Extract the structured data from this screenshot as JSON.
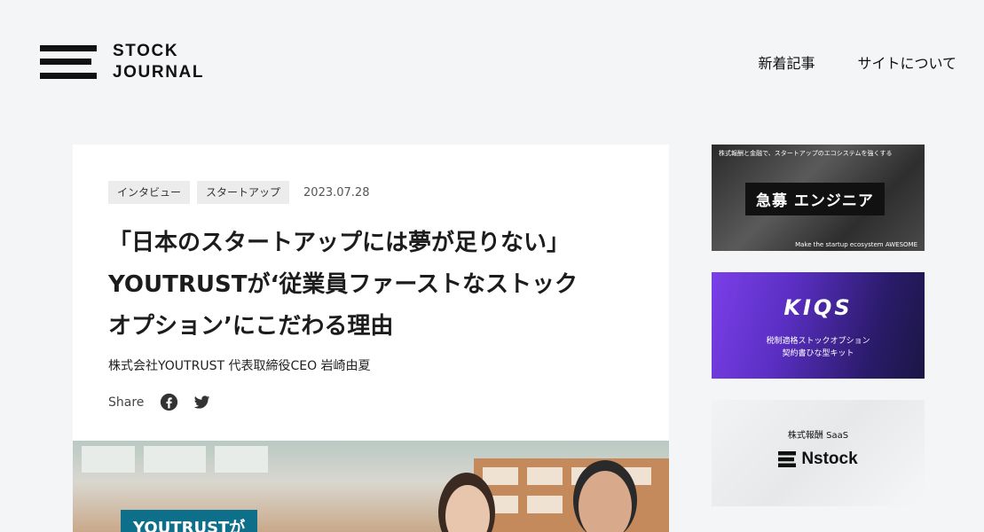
{
  "header": {
    "logo_line1": "STOCK",
    "logo_line2": "JOURNAL",
    "nav": [
      "新着記事",
      "サイトについて"
    ]
  },
  "article": {
    "tags": [
      "インタビュー",
      "スタートアップ"
    ],
    "date": "2023.07.28",
    "title_lines": [
      "「日本のスタートアップには夢が足りない」",
      "YOUTRUSTが‘従業員ファーストなストック",
      "オプション’にこだわる理由"
    ],
    "author": "株式会社YOUTRUST  代表取締役CEO  岩崎由夏",
    "share_label": "Share",
    "share_icons": [
      "facebook-icon",
      "twitter-icon"
    ],
    "hero_badge": "YOUTRUSTが"
  },
  "sidebar": {
    "banner1": {
      "top_text": "株式報酬と金融で、スタートアップのエコシステムを強くする",
      "main_text": "急募 エンジニア",
      "bottom_text": "Make the startup ecosystem AWESOME"
    },
    "banner2": {
      "brand": "KIQS",
      "line1": "税制適格ストックオプション",
      "line2": "契約書ひな型キット"
    },
    "banner3": {
      "sub": "株式報酬 SaaS",
      "brand": "Nstock"
    }
  },
  "colors": {
    "background": "#f4f5f7",
    "card": "#ffffff",
    "tag_bg": "#ececec",
    "hero_badge": "#0d6f8a",
    "kiqs_purple": "#7b3fe8"
  }
}
